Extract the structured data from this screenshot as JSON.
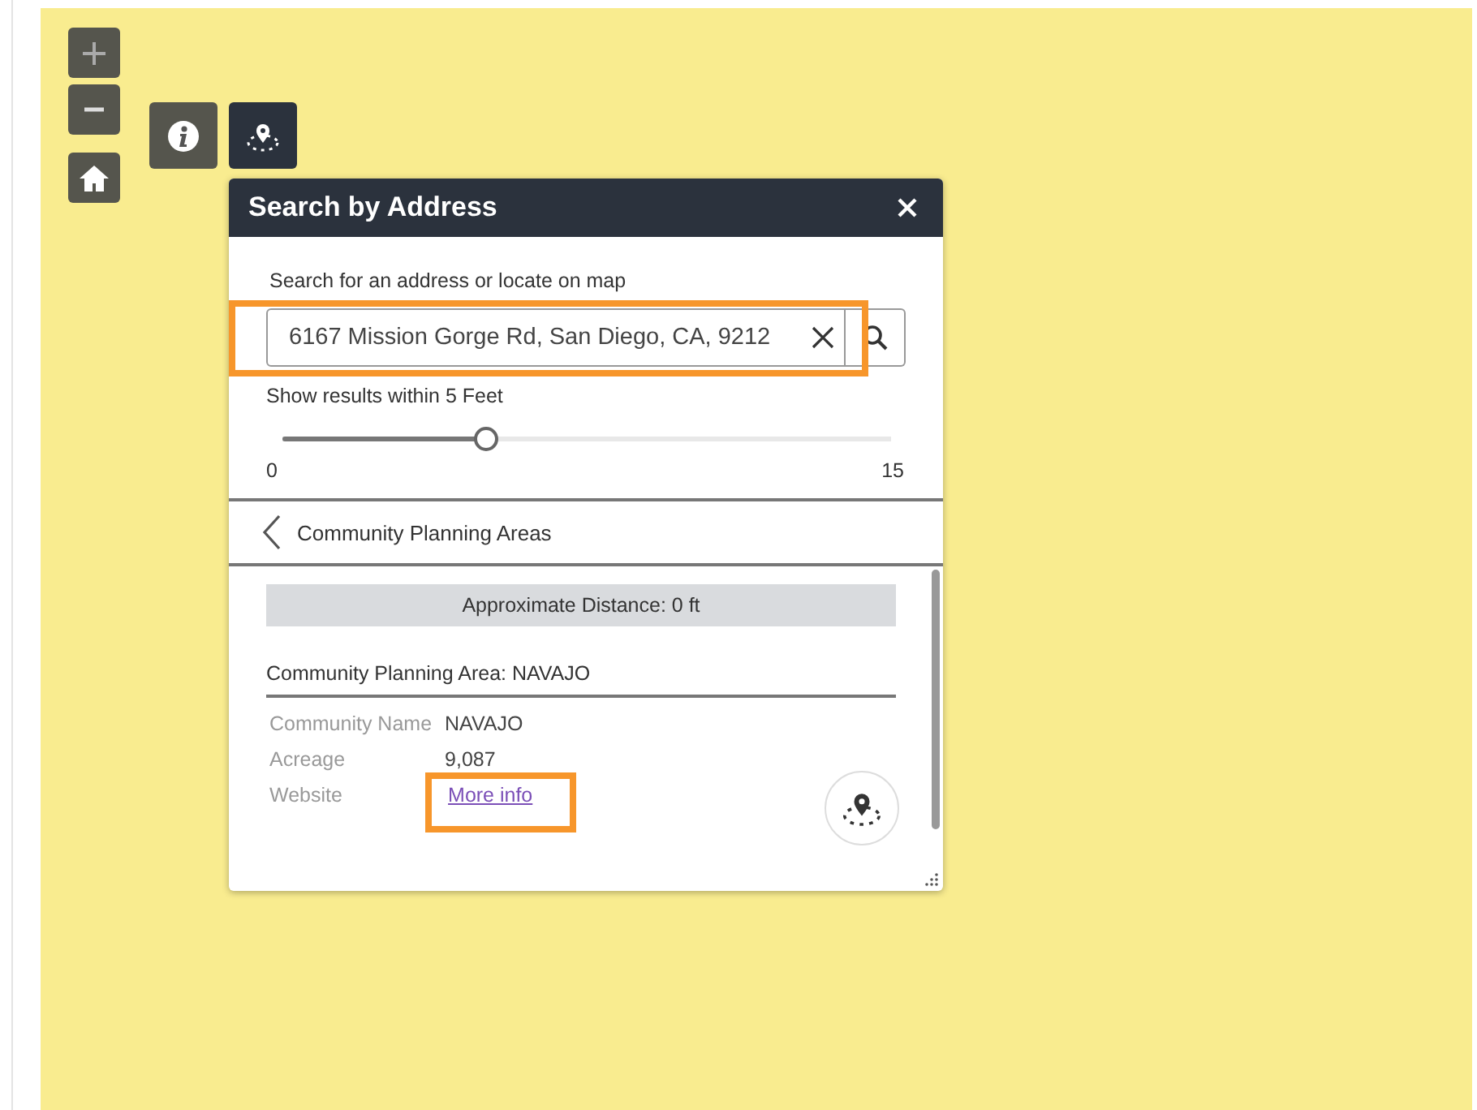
{
  "tools": [
    {
      "kind": "info",
      "selected": false
    },
    {
      "kind": "locate",
      "selected": true
    }
  ],
  "panel": {
    "title": "Search by Address",
    "search": {
      "label": "Search for an address or locate on map",
      "value": "6167 Mission Gorge Rd, San Diego, CA, 9212"
    },
    "slider": {
      "label": "Show results within 5 Feet",
      "level": 0.333,
      "min": "0",
      "max": "15"
    },
    "back": {
      "label": "Community Planning Areas"
    },
    "result": {
      "distance": "Approximate Distance: 0 ft",
      "heading": "Community Planning Area: NAVAJO",
      "fields": [
        {
          "kind": "text",
          "label": "Community Name",
          "value": "NAVAJO"
        },
        {
          "kind": "text",
          "label": "Acreage",
          "value": "9,087"
        },
        {
          "kind": "link",
          "label": "Website",
          "value": "More info"
        }
      ]
    }
  }
}
